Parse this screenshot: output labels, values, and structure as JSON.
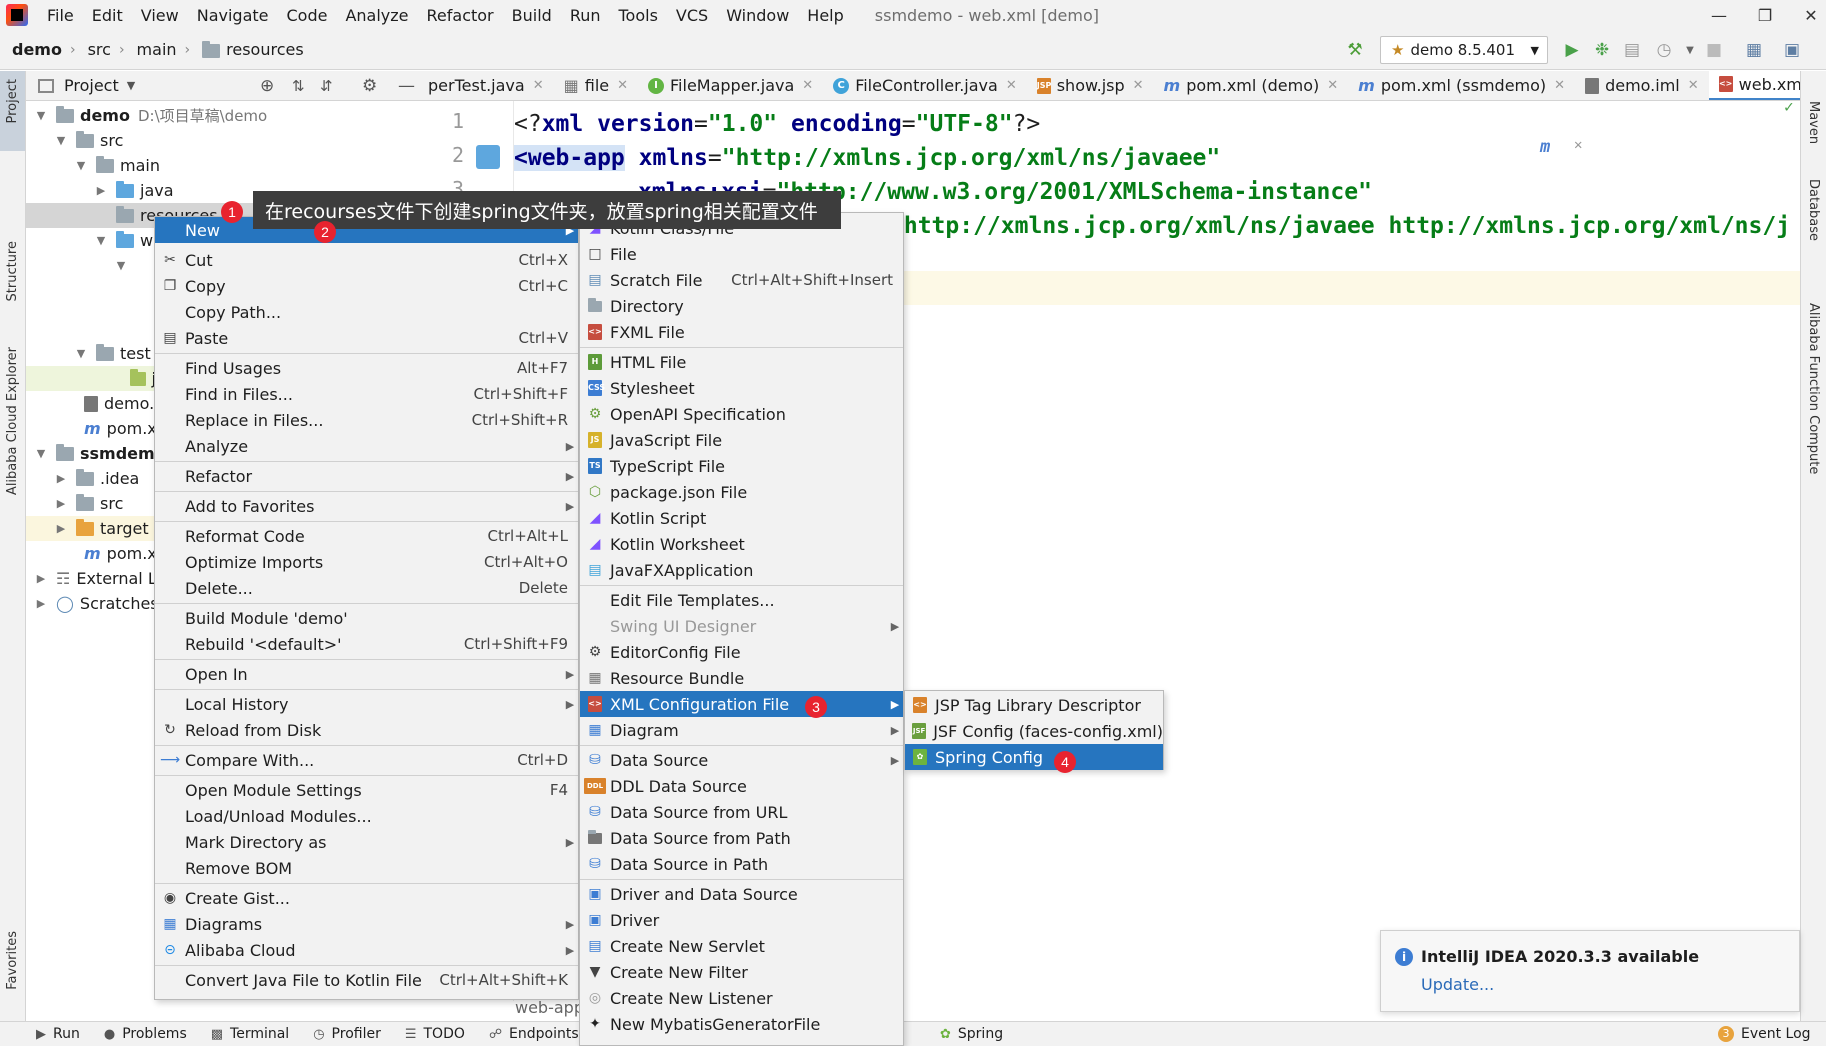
{
  "menubar": {
    "items": [
      "File",
      "Edit",
      "View",
      "Navigate",
      "Code",
      "Analyze",
      "Refactor",
      "Build",
      "Run",
      "Tools",
      "VCS",
      "Window",
      "Help"
    ],
    "window_title": "ssmdemo - web.xml [demo]"
  },
  "breadcrumb": [
    "demo",
    "src",
    "main",
    "resources"
  ],
  "run_config": "demo 8.5.401",
  "project_panel": {
    "title": "Project"
  },
  "tree": [
    {
      "label": "demo",
      "path": "D:\\项目草稿\\demo"
    },
    {
      "label": "src"
    },
    {
      "label": "main"
    },
    {
      "label": "java"
    },
    {
      "label": "resources"
    },
    {
      "label": "w"
    },
    {
      "label": ""
    },
    {
      "label": ""
    },
    {
      "label": ""
    },
    {
      "label": "test"
    },
    {
      "label": "j"
    },
    {
      "label": "demo.i"
    },
    {
      "label": "pom.xr"
    },
    {
      "label": "ssmdemo"
    },
    {
      "label": ".idea"
    },
    {
      "label": "src"
    },
    {
      "label": "target"
    },
    {
      "label": "pom.xr"
    },
    {
      "label": "External Li"
    },
    {
      "label": "Scratches"
    }
  ],
  "tabs": [
    "perTest.java",
    "file",
    "FileMapper.java",
    "FileController.java",
    "show.jsp",
    "pom.xml (demo)",
    "pom.xml (ssmdemo)",
    "demo.iml",
    "web.xml"
  ],
  "code": {
    "line1": {
      "num": "1",
      "a": "<?",
      "b": "xml",
      "c": " version",
      "d": "=",
      "e": "\"1.0\"",
      "f": " encoding",
      "g": "=",
      "h": "\"UTF-8\"",
      "i": "?>"
    },
    "line2": {
      "num": "2",
      "tag": "<web-app",
      "attr": " xmlns",
      "eq": "=",
      "val": "\"http://xmlns.jcp.org/xml/ns/javaee\""
    },
    "line3": {
      "num": "3",
      "attr": "xmlns:xsi",
      "eq": "=",
      "val": "\"http://www.w3.org/2001/XMLSchema-instance\""
    },
    "line4": {
      "val": "\"http://xmlns.jcp.org/xml/ns/javaee http://xmlns.jcp.org/xml/ns/j"
    }
  },
  "annotation": {
    "tooltip": "在recourses文件下创建spring文件夹，放置spring相关配置文件",
    "badges": [
      "1",
      "2",
      "3",
      "4"
    ]
  },
  "context_menu": [
    {
      "label": "New",
      "sub": true,
      "selected": true
    },
    {
      "label": "Cut",
      "shortcut": "Ctrl+X",
      "icon": "cut-icon"
    },
    {
      "label": "Copy",
      "shortcut": "Ctrl+C",
      "icon": "copy-icon"
    },
    {
      "label": "Copy Path...",
      "shortcut": ""
    },
    {
      "label": "Paste",
      "shortcut": "Ctrl+V",
      "icon": "paste-icon"
    },
    {
      "label": "Find Usages",
      "shortcut": "Alt+F7"
    },
    {
      "label": "Find in Files...",
      "shortcut": "Ctrl+Shift+F"
    },
    {
      "label": "Replace in Files...",
      "shortcut": "Ctrl+Shift+R"
    },
    {
      "label": "Analyze",
      "sub": true
    },
    {
      "label": "Refactor",
      "sub": true
    },
    {
      "label": "Add to Favorites",
      "sub": true
    },
    {
      "label": "Reformat Code",
      "shortcut": "Ctrl+Alt+L"
    },
    {
      "label": "Optimize Imports",
      "shortcut": "Ctrl+Alt+O"
    },
    {
      "label": "Delete...",
      "shortcut": "Delete"
    },
    {
      "label": "Build Module 'demo'",
      "shortcut": ""
    },
    {
      "label": "Rebuild '<default>'",
      "shortcut": "Ctrl+Shift+F9"
    },
    {
      "label": "Open In",
      "sub": true
    },
    {
      "label": "Local History",
      "sub": true
    },
    {
      "label": "Reload from Disk",
      "icon": "reload-icon"
    },
    {
      "label": "Compare With...",
      "shortcut": "Ctrl+D",
      "icon": "compare-icon"
    },
    {
      "label": "Open Module Settings",
      "shortcut": "F4"
    },
    {
      "label": "Load/Unload Modules..."
    },
    {
      "label": "Mark Directory as",
      "sub": true
    },
    {
      "label": "Remove BOM"
    },
    {
      "label": "Create Gist...",
      "icon": "github-icon"
    },
    {
      "label": "Diagrams",
      "sub": true,
      "icon": "diagram-icon"
    },
    {
      "label": "Alibaba Cloud",
      "sub": true,
      "icon": "alibaba-cloud-icon"
    },
    {
      "label": "Convert Java File to Kotlin File",
      "shortcut": "Ctrl+Alt+Shift+K"
    }
  ],
  "new_menu": [
    {
      "label": "Kotlin Class/File"
    },
    {
      "label": "File"
    },
    {
      "label": "Scratch File",
      "shortcut": "Ctrl+Alt+Shift+Insert"
    },
    {
      "label": "Directory"
    },
    {
      "label": "FXML File"
    },
    {
      "label": "HTML File"
    },
    {
      "label": "Stylesheet"
    },
    {
      "label": "OpenAPI Specification"
    },
    {
      "label": "JavaScript File"
    },
    {
      "label": "TypeScript File"
    },
    {
      "label": "package.json File"
    },
    {
      "label": "Kotlin Script"
    },
    {
      "label": "Kotlin Worksheet"
    },
    {
      "label": "JavaFXApplication"
    },
    {
      "label": "Edit File Templates..."
    },
    {
      "label": "Swing UI Designer",
      "disabled": true
    },
    {
      "label": "EditorConfig File"
    },
    {
      "label": "Resource Bundle"
    },
    {
      "label": "XML Configuration File",
      "selected": true
    },
    {
      "label": "Diagram"
    },
    {
      "label": "Data Source"
    },
    {
      "label": "DDL Data Source"
    },
    {
      "label": "Data Source from URL"
    },
    {
      "label": "Data Source from Path"
    },
    {
      "label": "Data Source in Path"
    },
    {
      "label": "Driver and Data Source"
    },
    {
      "label": "Driver"
    },
    {
      "label": "Create New Servlet"
    },
    {
      "label": "Create New Filter"
    },
    {
      "label": "Create New Listener"
    },
    {
      "label": "New MybatisGeneratorFile"
    }
  ],
  "xml_menu": [
    {
      "label": "JSP Tag Library Descriptor"
    },
    {
      "label": "JSF Config (faces-config.xml)"
    },
    {
      "label": "Spring Config",
      "selected": true
    }
  ],
  "editor_behind_text": "web-app",
  "notification": {
    "title": "IntelliJ IDEA 2020.3.3 available",
    "link": "Update..."
  },
  "left_stripe": [
    "Project",
    "Structure",
    "Alibaba Cloud Explorer",
    "Favorites"
  ],
  "right_stripe": [
    "Maven",
    "Database",
    "Alibaba Function Compute"
  ],
  "bottom_bar": [
    "Run",
    "Problems",
    "Terminal",
    "Profiler",
    "TODO",
    "Endpoints",
    "Spring",
    "Event Log"
  ],
  "bottom_hidden": "v",
  "colors": {
    "selection": "#2675bf",
    "badge": "#e8232f",
    "tooltip_bg": "#3d3d3d"
  }
}
